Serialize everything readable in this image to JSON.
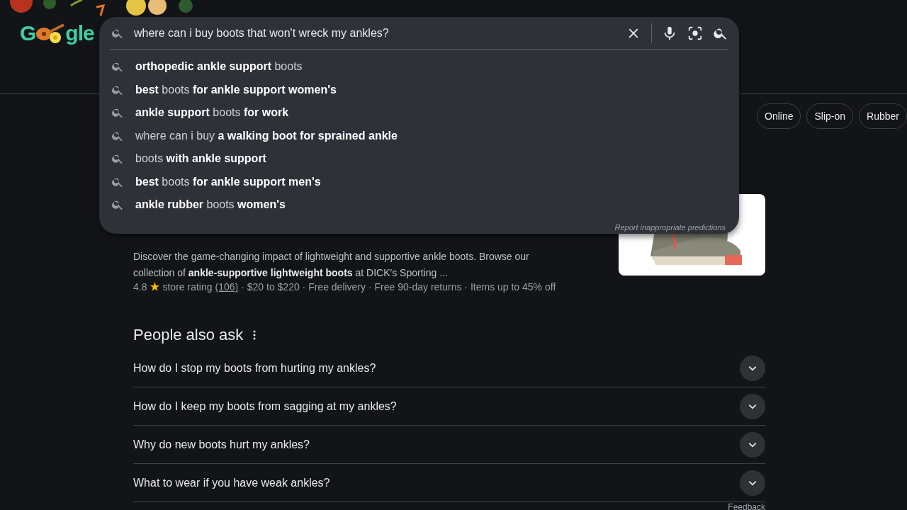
{
  "logo": {
    "start": "G",
    "end": "gle"
  },
  "search": {
    "query": "where can i buy boots that won't wreck my ankles?",
    "suggestions": [
      "**orthopedic ankle support** boots",
      "**best** boots **for ankle support women's**",
      "**ankle support** boots **for work**",
      "where can i buy **a walking boot for sprained ankle**",
      "boots **with ankle support**",
      "**best** boots **for ankle support men's**",
      "**ankle rubber** boots **women's**"
    ],
    "report": "Report inappropriate predictions"
  },
  "chips": [
    {
      "label": "Online",
      "selected": false
    },
    {
      "label": "Slip-on",
      "selected": false
    },
    {
      "label": "Rubber",
      "selected": false
    }
  ],
  "result": {
    "snippet": "Discover the game-changing impact of lightweight and supportive ankle boots. Browse our collection of **ankle-supportive lightweight boots** at DICK's Sporting ...",
    "rating": "4.8",
    "rating_label": "store rating",
    "reviews": "(106)",
    "details": "· $20 to $220 · Free delivery · Free 90-day returns · Items up to 45% off"
  },
  "people_also_ask": {
    "heading": "People also ask",
    "questions": [
      {
        "text": "How do I stop my boots from hurting my ankles?",
        "expanded": false
      },
      {
        "text": "How do I keep my boots from sagging at my ankles?",
        "expanded": false
      },
      {
        "text": "Why do new boots hurt my ankles?",
        "expanded": false
      },
      {
        "text": "What to wear if you have weak ankles?",
        "expanded": false
      }
    ],
    "feedback": "Feedback"
  }
}
